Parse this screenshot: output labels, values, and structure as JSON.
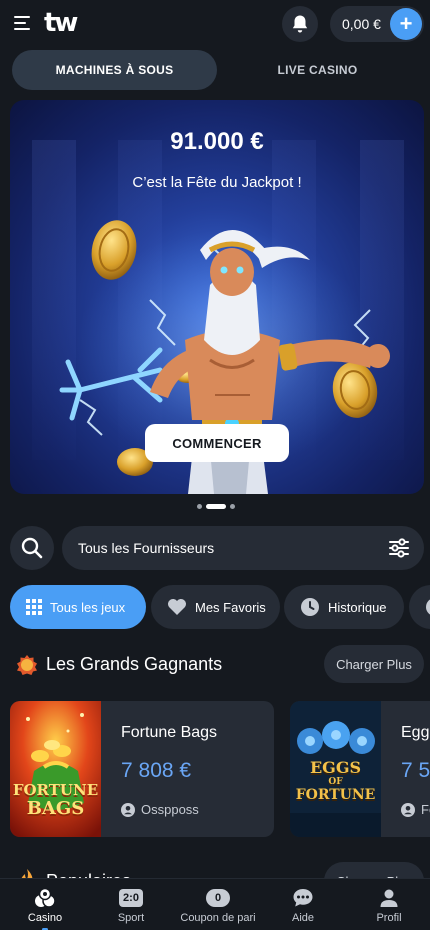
{
  "header": {
    "logo": "tw",
    "wallet_amount": "0,00 €",
    "add_label": "+"
  },
  "tabs": [
    {
      "label": "MACHINES À SOUS",
      "active": true
    },
    {
      "label": "LIVE CASINO",
      "active": false
    }
  ],
  "banner": {
    "amount": "91.000 €",
    "subtitle": "C’est la Fête du Jackpot !",
    "cta": "COMMENCER",
    "slide_count": 3,
    "active_slide": 2
  },
  "search": {
    "provider_label": "Tous les Fournisseurs"
  },
  "chips": [
    {
      "label": "Tous les jeux",
      "icon": "grid-icon",
      "active": true
    },
    {
      "label": "Mes Favoris",
      "icon": "heart-icon",
      "active": false
    },
    {
      "label": "Historique",
      "icon": "clock-icon",
      "active": false
    }
  ],
  "winners": {
    "title": "Les Grands Gagnants",
    "load_more": "Charger Plus",
    "cards": [
      {
        "game": "Fortune Bags",
        "amount": "7 808 €",
        "user": "Osspposs",
        "art_line1": "FORTUNE",
        "art_line2": "BAGS"
      },
      {
        "game": "Eggs of Fortune",
        "amount": "7 5",
        "user": "Fo",
        "art_line1": "EGGS",
        "art_line2": "FORTUNE",
        "art_small": "OF"
      }
    ]
  },
  "popular": {
    "title": "Populaires",
    "load_more": "Charger Plus"
  },
  "bottom_nav": [
    {
      "label": "Casino",
      "active": true
    },
    {
      "label": "Sport",
      "badge": "2:0",
      "active": false
    },
    {
      "label": "Coupon de pari",
      "badge": "0",
      "active": false
    },
    {
      "label": "Aide",
      "active": false
    },
    {
      "label": "Profil",
      "active": false
    }
  ],
  "colors": {
    "background": "#15191f",
    "surface": "#262c36",
    "accent": "#4a9ef5",
    "amount": "#6aa6f5"
  }
}
